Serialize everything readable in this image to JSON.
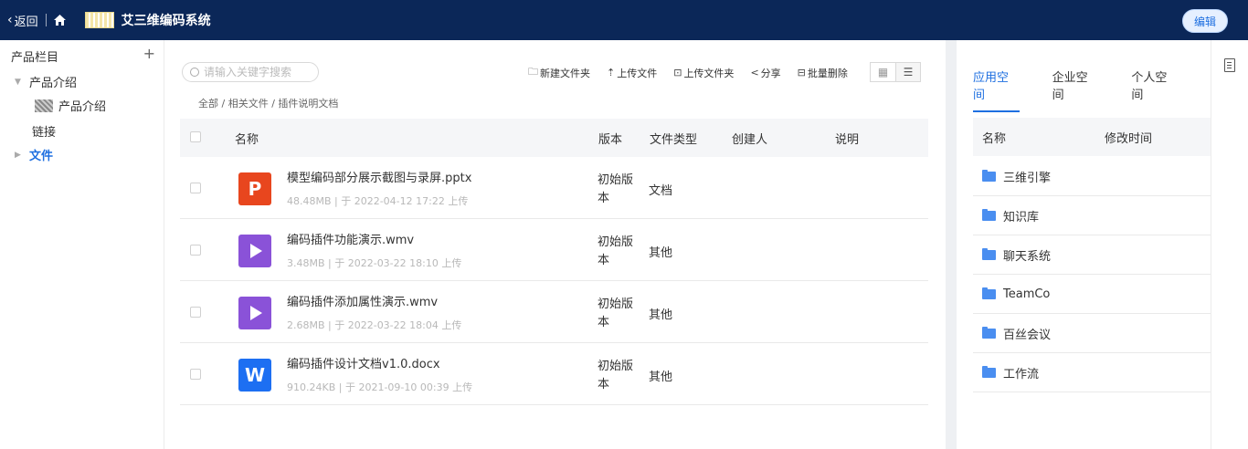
{
  "header": {
    "back_label": "返回",
    "title": "艾三维编码系统",
    "edit_label": "编辑"
  },
  "sidebar": {
    "title": "产品栏目",
    "add_label": "+",
    "items": [
      {
        "label": "产品介绍",
        "expanded": true
      },
      {
        "label": "产品介绍"
      },
      {
        "label": "链接"
      },
      {
        "label": "文件",
        "active": true
      }
    ]
  },
  "main": {
    "search_placeholder": "请输入关键字搜索",
    "toolbar": {
      "new_folder": "新建文件夹",
      "upload_file": "上传文件",
      "upload_folder": "上传文件夹",
      "share": "分享",
      "batch_delete": "批量删除"
    },
    "breadcrumb": "全部 / 相关文件 / 插件说明文档",
    "columns": {
      "name": "名称",
      "version": "版本",
      "type": "文件类型",
      "creator": "创建人",
      "desc": "说明"
    },
    "files": [
      {
        "icon": "ppt-file-icon",
        "icon_text": "P",
        "name": "模型编码部分展示截图与录屏.pptx",
        "meta": "48.48MB  |  于 2022-04-12 17:22 上传",
        "version": "初始版本",
        "type": "文档"
      },
      {
        "icon": "video-file-icon",
        "icon_text": "",
        "name": "编码插件功能演示.wmv",
        "meta": "3.48MB  |  于 2022-03-22 18:10 上传",
        "version": "初始版本",
        "type": "其他"
      },
      {
        "icon": "video-file-icon",
        "icon_text": "",
        "name": "编码插件添加属性演示.wmv",
        "meta": "2.68MB  |  于 2022-03-22 18:04 上传",
        "version": "初始版本",
        "type": "其他"
      },
      {
        "icon": "word-file-icon",
        "icon_text": "W",
        "name": "编码插件设计文档v1.0.docx",
        "meta": "910.24KB  |  于 2021-09-10 00:39 上传",
        "version": "初始版本",
        "type": "其他"
      }
    ]
  },
  "right_panel": {
    "tabs": [
      {
        "label": "应用空间",
        "active": true
      },
      {
        "label": "企业空间"
      },
      {
        "label": "个人空间"
      }
    ],
    "columns": {
      "name": "名称",
      "modified": "修改时间"
    },
    "folders": [
      "三维引擎",
      "知识库",
      "聊天系统",
      "TeamCo",
      "百丝会议",
      "工作流"
    ]
  },
  "colors": {
    "topbar": "#0b2758",
    "accent": "#1e6fe0",
    "ppt": "#e8461e",
    "video": "#8a52d8",
    "word": "#1d6ff2"
  }
}
